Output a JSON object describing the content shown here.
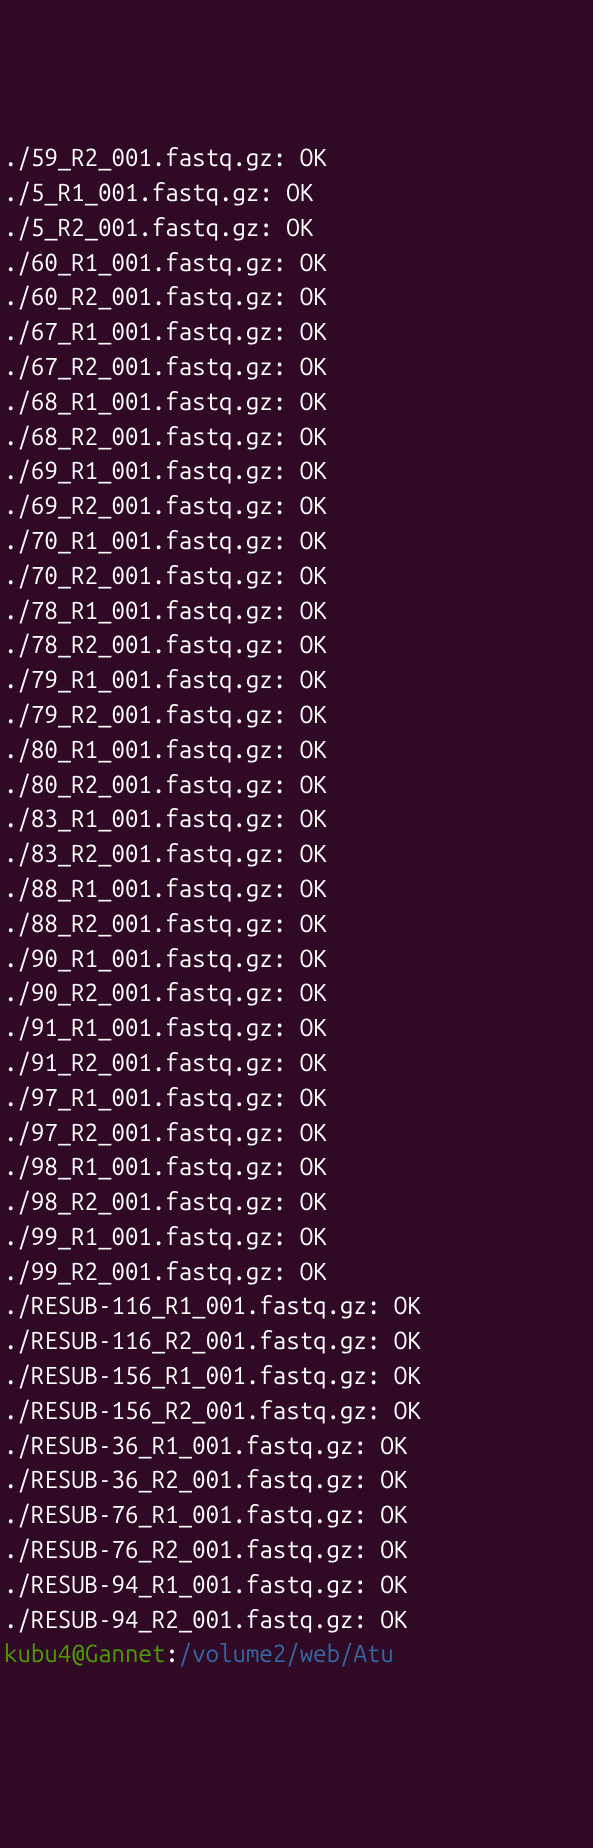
{
  "lines": [
    {
      "file": "./59_R2_001.fastq.gz",
      "status": "OK"
    },
    {
      "file": "./5_R1_001.fastq.gz",
      "status": "OK"
    },
    {
      "file": "./5_R2_001.fastq.gz",
      "status": "OK"
    },
    {
      "file": "./60_R1_001.fastq.gz",
      "status": "OK"
    },
    {
      "file": "./60_R2_001.fastq.gz",
      "status": "OK"
    },
    {
      "file": "./67_R1_001.fastq.gz",
      "status": "OK"
    },
    {
      "file": "./67_R2_001.fastq.gz",
      "status": "OK"
    },
    {
      "file": "./68_R1_001.fastq.gz",
      "status": "OK"
    },
    {
      "file": "./68_R2_001.fastq.gz",
      "status": "OK"
    },
    {
      "file": "./69_R1_001.fastq.gz",
      "status": "OK"
    },
    {
      "file": "./69_R2_001.fastq.gz",
      "status": "OK"
    },
    {
      "file": "./70_R1_001.fastq.gz",
      "status": "OK"
    },
    {
      "file": "./70_R2_001.fastq.gz",
      "status": "OK"
    },
    {
      "file": "./78_R1_001.fastq.gz",
      "status": "OK"
    },
    {
      "file": "./78_R2_001.fastq.gz",
      "status": "OK"
    },
    {
      "file": "./79_R1_001.fastq.gz",
      "status": "OK"
    },
    {
      "file": "./79_R2_001.fastq.gz",
      "status": "OK"
    },
    {
      "file": "./80_R1_001.fastq.gz",
      "status": "OK"
    },
    {
      "file": "./80_R2_001.fastq.gz",
      "status": "OK"
    },
    {
      "file": "./83_R1_001.fastq.gz",
      "status": "OK"
    },
    {
      "file": "./83_R2_001.fastq.gz",
      "status": "OK"
    },
    {
      "file": "./88_R1_001.fastq.gz",
      "status": "OK"
    },
    {
      "file": "./88_R2_001.fastq.gz",
      "status": "OK"
    },
    {
      "file": "./90_R1_001.fastq.gz",
      "status": "OK"
    },
    {
      "file": "./90_R2_001.fastq.gz",
      "status": "OK"
    },
    {
      "file": "./91_R1_001.fastq.gz",
      "status": "OK"
    },
    {
      "file": "./91_R2_001.fastq.gz",
      "status": "OK"
    },
    {
      "file": "./97_R1_001.fastq.gz",
      "status": "OK"
    },
    {
      "file": "./97_R2_001.fastq.gz",
      "status": "OK"
    },
    {
      "file": "./98_R1_001.fastq.gz",
      "status": "OK"
    },
    {
      "file": "./98_R2_001.fastq.gz",
      "status": "OK"
    },
    {
      "file": "./99_R1_001.fastq.gz",
      "status": "OK"
    },
    {
      "file": "./99_R2_001.fastq.gz",
      "status": "OK"
    },
    {
      "file": "./RESUB-116_R1_001.fastq.gz",
      "status": "OK"
    },
    {
      "file": "./RESUB-116_R2_001.fastq.gz",
      "status": "OK"
    },
    {
      "file": "./RESUB-156_R1_001.fastq.gz",
      "status": "OK"
    },
    {
      "file": "./RESUB-156_R2_001.fastq.gz",
      "status": "OK"
    },
    {
      "file": "./RESUB-36_R1_001.fastq.gz",
      "status": "OK"
    },
    {
      "file": "./RESUB-36_R2_001.fastq.gz",
      "status": "OK"
    },
    {
      "file": "./RESUB-76_R1_001.fastq.gz",
      "status": "OK"
    },
    {
      "file": "./RESUB-76_R2_001.fastq.gz",
      "status": "OK"
    },
    {
      "file": "./RESUB-94_R1_001.fastq.gz",
      "status": "OK"
    },
    {
      "file": "./RESUB-94_R2_001.fastq.gz",
      "status": "OK"
    }
  ],
  "prompt": {
    "user_host": "kubu4@Gannet",
    "colon": ":",
    "path": "/volume2/web/Atu"
  }
}
